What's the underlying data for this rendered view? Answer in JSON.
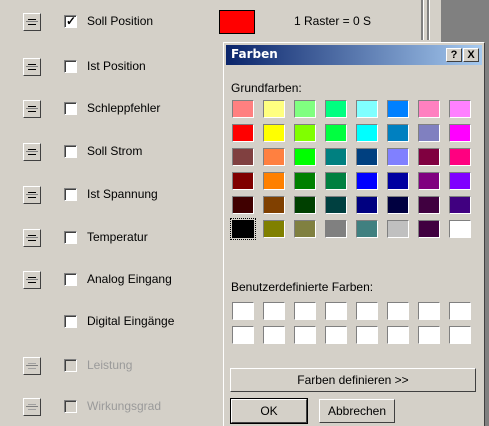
{
  "background": {
    "raster_text": "1 Raster = 0 S",
    "swatch_color": "#ff0000"
  },
  "rows": [
    {
      "label": "Soll Position",
      "checked": true,
      "enabled": true,
      "spinner": true
    },
    {
      "label": "Ist Position",
      "checked": false,
      "enabled": true,
      "spinner": true
    },
    {
      "label": "Schleppfehler",
      "checked": false,
      "enabled": true,
      "spinner": true
    },
    {
      "label": "Soll Strom",
      "checked": false,
      "enabled": true,
      "spinner": true
    },
    {
      "label": "Ist Spannung",
      "checked": false,
      "enabled": true,
      "spinner": true
    },
    {
      "label": "Temperatur",
      "checked": false,
      "enabled": true,
      "spinner": true
    },
    {
      "label": "Analog Eingang",
      "checked": false,
      "enabled": true,
      "spinner": true
    },
    {
      "label": "Digital Eingänge",
      "checked": false,
      "enabled": true,
      "spinner": false
    },
    {
      "label": "Leistung",
      "checked": false,
      "enabled": false,
      "spinner": true
    },
    {
      "label": "Wirkungsgrad",
      "checked": false,
      "enabled": false,
      "spinner": true
    }
  ],
  "dialog": {
    "title": "Farben",
    "help_label": "?",
    "close_label": "X",
    "basic_colors_label": "Grundfarben:",
    "custom_colors_label": "Benutzerdefinierte Farben:",
    "define_button": "Farben definieren >>",
    "ok_button": "OK",
    "cancel_button": "Abbrechen",
    "basic_colors": [
      [
        "#ff8080",
        "#ffff80",
        "#80ff80",
        "#00ff80",
        "#80ffff",
        "#0080ff",
        "#ff80c0",
        "#ff80ff"
      ],
      [
        "#ff0000",
        "#ffff00",
        "#80ff00",
        "#00ff40",
        "#00ffff",
        "#0080c0",
        "#8080c0",
        "#ff00ff"
      ],
      [
        "#804040",
        "#ff8040",
        "#00ff00",
        "#008080",
        "#004080",
        "#8080ff",
        "#800040",
        "#ff0080"
      ],
      [
        "#800000",
        "#ff8000",
        "#008000",
        "#008040",
        "#0000ff",
        "#0000a0",
        "#800080",
        "#8000ff"
      ],
      [
        "#400000",
        "#804000",
        "#004000",
        "#004040",
        "#000080",
        "#000040",
        "#400040",
        "#400080"
      ],
      [
        "#000000",
        "#808000",
        "#808040",
        "#808080",
        "#408080",
        "#c0c0c0",
        "#400040",
        "#ffffff"
      ]
    ],
    "selected_color": "#000000"
  }
}
